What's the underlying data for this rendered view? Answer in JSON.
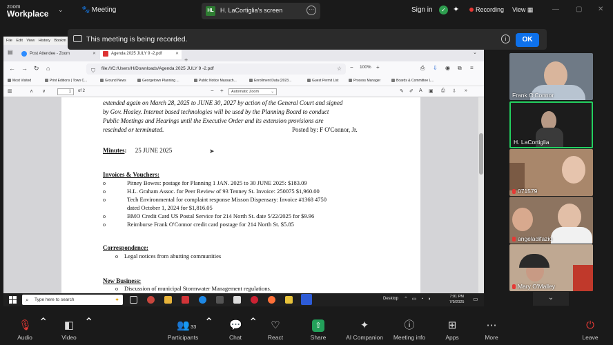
{
  "app": {
    "logo_top": "zoom",
    "logo_bottom": "Workplace",
    "meeting_label": "Meeting",
    "shared_screen_badge": "HL",
    "shared_screen_title": "H. LaCortiglia's screen",
    "sign_in": "Sign in",
    "recording": "Recording",
    "view": "View",
    "colors": {
      "accent": "#0e71eb",
      "active_speaker": "#23d160",
      "recording": "#e53935",
      "share": "#23a05a"
    }
  },
  "banner": {
    "text": "This meeting is being recorded.",
    "ok_label": "OK"
  },
  "browser": {
    "menu": [
      "File",
      "Edit",
      "View",
      "History",
      "Bookm"
    ],
    "tabs": [
      {
        "label": "Post Attendee - Zoom",
        "active": false
      },
      {
        "label": "Agenda 2025 JULY 9 -2.pdf",
        "active": true
      }
    ],
    "url": "file:///C:/Users/H/Downloads/Agenda 2025 JULY 9 -2.pdf",
    "zoom_level": "100%",
    "bookmarks": [
      "Most Visited",
      "Print Editions | Town C...",
      "Ground News",
      "Georgetown Planning ...",
      "Public Notice Massach...",
      "Enrollment Data (2023...",
      "Guest Permit List",
      "Process Manager",
      "Boards & Committee L..."
    ],
    "pdf": {
      "page_current": "1",
      "page_total": "of 2",
      "zoom_mode": "Automatic Zoom"
    }
  },
  "document": {
    "intro_lines": [
      "extended again on March 28, 2025 to JUNE 30, 2027 by action of the General Court and signed",
      "by Gov. Healey.  Internet based technologies will be used by the Planning Board to conduct",
      "Public Meetings and Hearings until the Executive Order and its extension provisions are",
      "rescinded or terminated."
    ],
    "posted_by": "Posted by: F O'Connor, Jr.",
    "minutes_heading": "Minutes",
    "minutes_date": "25 JUNE 2025",
    "invoices_heading": "Invoices & Vouchers",
    "invoices": [
      "Pitney Bowes: postage for Planning 1 JAN. 2025 to 30 JUNE 2025: $183.09",
      "H.L. Graham Assoc. for Peer Review of 93 Tenney St. Invoice: 250075 $1,960.00",
      "Tech Environmental for complaint response Misson Dispensary: Invoice #1368 4750",
      "BMO Credit Card US Postal Service for 214 North St. date 5/22/2025 for $9.96",
      "Reimburse Frank O'Connor credit card postage for 214 North St. $5.85"
    ],
    "invoice_continuation": "dated October 1, 2024 for $1,816.05",
    "correspondence_heading": "Correspondence",
    "correspondence_items": [
      "Legal notices from abutting communities"
    ],
    "new_business_heading": "New Business",
    "new_business_items": [
      "Discussion of municipal Stormwater Management regulations."
    ],
    "bullet_mark": "o"
  },
  "taskbar": {
    "search_placeholder": "Type here to search",
    "desktop_label": "Desktop",
    "time": "7:01 PM",
    "date": "7/9/2025"
  },
  "participants": [
    {
      "name": "Frank O'Connor",
      "muted": false
    },
    {
      "name": "H. LaCortiglia",
      "muted": false,
      "active": true
    },
    {
      "name": "071579",
      "muted": true
    },
    {
      "name": "angeladifazio",
      "muted": true
    },
    {
      "name": "Mary O'Malley",
      "muted": true
    }
  ],
  "toolbar": {
    "audio": "Audio",
    "video": "Video",
    "participants": "Participants",
    "participants_count": "33",
    "chat": "Chat",
    "react": "React",
    "share": "Share",
    "ai_companion": "AI Companion",
    "meeting_info": "Meeting info",
    "apps": "Apps",
    "more": "More",
    "leave": "Leave"
  }
}
